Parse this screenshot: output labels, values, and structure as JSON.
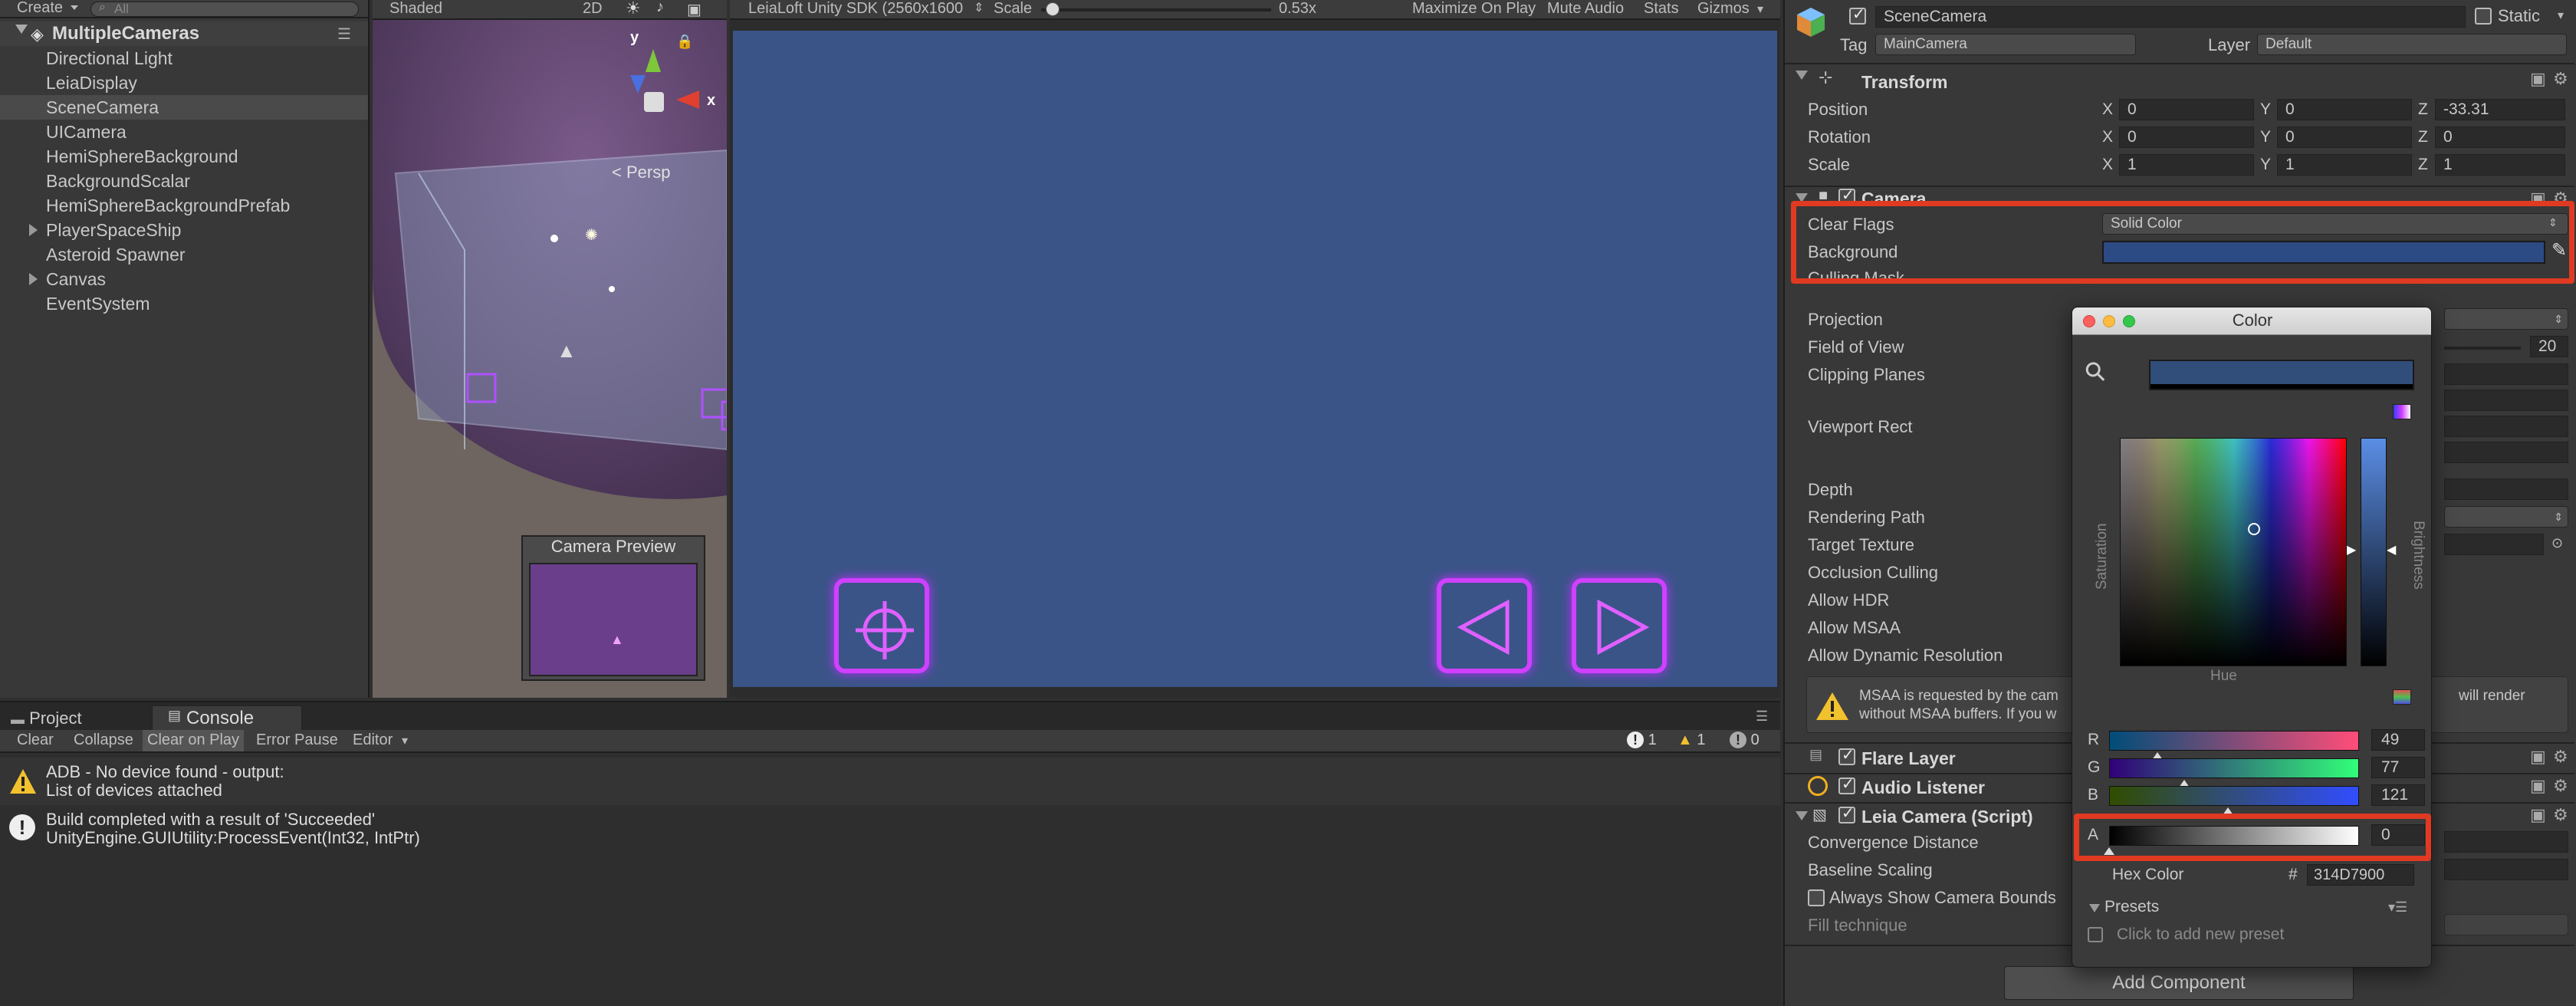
{
  "hierarchy": {
    "create_label": "Create",
    "search_placeholder": "All",
    "scene_name": "MultipleCameras",
    "items": [
      {
        "label": "Directional Light"
      },
      {
        "label": "LeiaDisplay"
      },
      {
        "label": "SceneCamera",
        "selected": true
      },
      {
        "label": "UICamera"
      },
      {
        "label": "HemiSphereBackground"
      },
      {
        "label": "BackgroundScalar"
      },
      {
        "label": "HemiSphereBackgroundPrefab"
      },
      {
        "label": "PlayerSpaceShip",
        "expandable": true
      },
      {
        "label": "Asteroid Spawner"
      },
      {
        "label": "Canvas",
        "expandable": true
      },
      {
        "label": "EventSystem"
      }
    ]
  },
  "scene": {
    "shading": "Shaded",
    "mode_2d": "2D",
    "persp": "< Persp",
    "preview_title": "Camera Preview",
    "gizmo_y": "y",
    "gizmo_x": "x"
  },
  "game": {
    "resolution": "LeiaLoft Unity SDK (2560x1600",
    "scale_label": "Scale",
    "scale_value": "0.53x",
    "scale_fraction": 0.02,
    "maximize": "Maximize On Play",
    "mute": "Mute Audio",
    "stats": "Stats",
    "gizmos": "Gizmos",
    "bg_color": "#3a5488"
  },
  "console": {
    "tab_project": "Project",
    "tab_console": "Console",
    "clear": "Clear",
    "collapse": "Collapse",
    "clear_on_play": "Clear on Play",
    "error_pause": "Error Pause",
    "editor": "Editor",
    "count_errors": "1",
    "count_warnings": "1",
    "count_logs": "0",
    "messages": [
      {
        "type": "warning",
        "line1": "ADB - No device found - output:",
        "line2": "List of devices attached"
      },
      {
        "type": "info",
        "line1": "Build completed with a result of 'Succeeded'",
        "line2": "UnityEngine.GUIUtility:ProcessEvent(Int32, IntPtr)"
      }
    ]
  },
  "inspector": {
    "object_name": "SceneCamera",
    "static_label": "Static",
    "tag_label": "Tag",
    "tag_value": "MainCamera",
    "layer_label": "Layer",
    "layer_value": "Default",
    "transform": {
      "title": "Transform",
      "position_label": "Position",
      "position": [
        "0",
        "0",
        "-33.31"
      ],
      "rotation_label": "Rotation",
      "rotation": [
        "0",
        "0",
        "0"
      ],
      "scale_label": "Scale",
      "scale": [
        "1",
        "1",
        "1"
      ],
      "axes": [
        "X",
        "Y",
        "Z"
      ]
    },
    "camera": {
      "title": "Camera",
      "clear_flags_label": "Clear Flags",
      "clear_flags_value": "Solid Color",
      "background_label": "Background",
      "background_color": "#2c4a84",
      "culling_mask_label": "Culling Mask",
      "projection_label": "Projection",
      "fov_label": "Field of View",
      "fov_value": "20",
      "clipping_label": "Clipping Planes",
      "viewport_label": "Viewport Rect",
      "depth_label": "Depth",
      "rendering_path_label": "Rendering Path",
      "target_texture_label": "Target Texture",
      "occlusion_label": "Occlusion Culling",
      "hdr_label": "Allow HDR",
      "msaa_label": "Allow MSAA",
      "dynres_label": "Allow Dynamic Resolution",
      "msaa_msg_a": "MSAA is requested by the cam",
      "msaa_msg_b": "without MSAA buffers. If you w",
      "msaa_msg_c": "will render"
    },
    "flare_layer": "Flare Layer",
    "audio_listener": "Audio Listener",
    "leia_camera": {
      "title": "Leia Camera (Script)",
      "convergence_label": "Convergence Distance",
      "baseline_label": "Baseline Scaling",
      "always_show_label": "Always Show Camera Bounds",
      "fill_label": "Fill technique"
    },
    "add_component": "Add Component"
  },
  "color_picker": {
    "title": "Color",
    "preview_color": "#314d79",
    "hue_label": "Hue",
    "saturation_label": "Saturation",
    "brightness_label": "Brightness",
    "r_label": "R",
    "r": "49",
    "g_label": "G",
    "g": "77",
    "b_label": "B",
    "b": "121",
    "a_label": "A",
    "a": "0",
    "hex_label": "Hex Color",
    "hash": "#",
    "hex_value": "314D7900",
    "presets_label": "Presets",
    "add_preset_label": "Click to add new preset"
  },
  "colors": {
    "highlight": "#e03a22",
    "button_glow": "#d040ff"
  }
}
